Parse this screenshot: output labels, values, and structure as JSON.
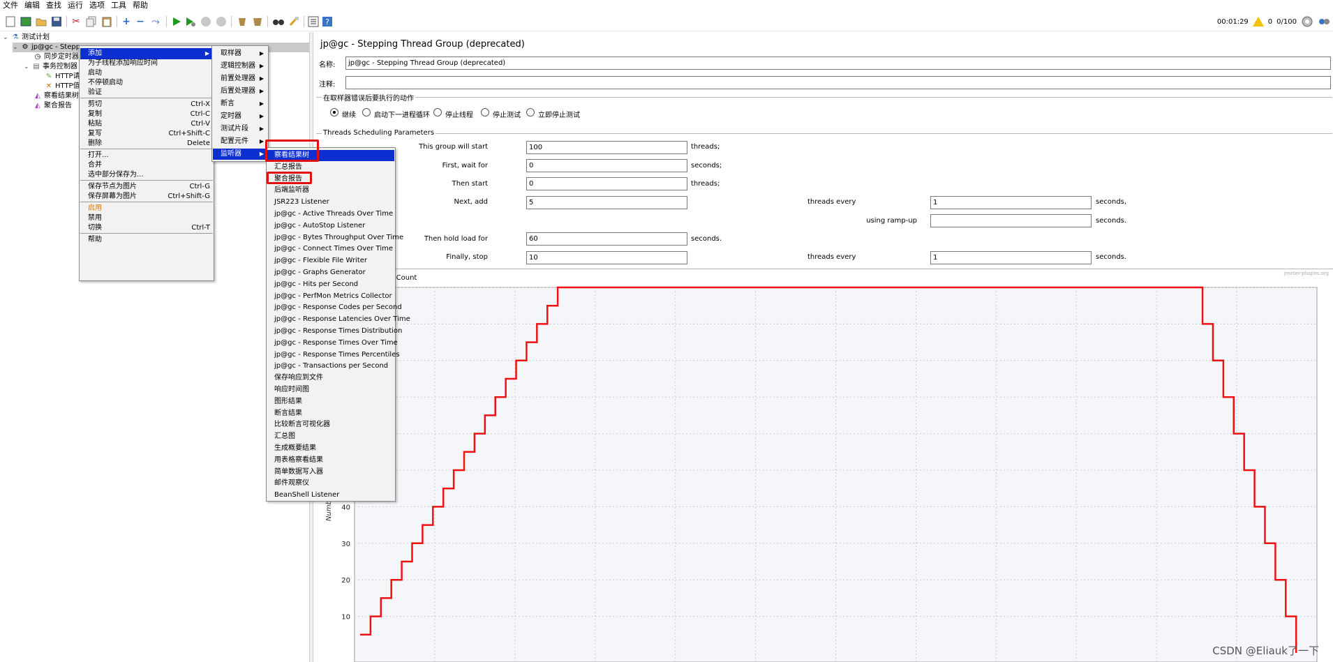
{
  "menubar": [
    "文件",
    "编辑",
    "查找",
    "运行",
    "选项",
    "工具",
    "帮助"
  ],
  "toolbar_right": {
    "timer": "00:01:29",
    "warn_count": "0",
    "threads": "0/100"
  },
  "tree": {
    "root": "测试计划",
    "group": "jp@gc - Stepp",
    "sync_timer": "同步定时器",
    "controller": "事务控制器",
    "http1": "HTTP请",
    "http2": "HTTP值",
    "view_results": "察看结果树",
    "aggregate": "聚合报告"
  },
  "ctx_menu": {
    "items": [
      {
        "label": "添加",
        "arrow": true,
        "selected": true
      },
      {
        "label": "为子线程添加响应时间"
      },
      {
        "label": "启动"
      },
      {
        "label": "不停顿启动"
      },
      {
        "label": "验证"
      },
      {
        "sep": true
      },
      {
        "label": "剪切",
        "sc": "Ctrl-X"
      },
      {
        "label": "复制",
        "sc": "Ctrl-C"
      },
      {
        "label": "粘贴",
        "sc": "Ctrl-V"
      },
      {
        "label": "复写",
        "sc": "Ctrl+Shift-C"
      },
      {
        "label": "删除",
        "sc": "Delete"
      },
      {
        "sep": true
      },
      {
        "label": "打开..."
      },
      {
        "label": "合并"
      },
      {
        "label": "选中部分保存为..."
      },
      {
        "sep": true
      },
      {
        "label": "保存节点为图片",
        "sc": "Ctrl-G"
      },
      {
        "label": "保存屏幕为图片",
        "sc": "Ctrl+Shift-G"
      },
      {
        "sep": true
      },
      {
        "label": "启用",
        "orange": true
      },
      {
        "label": "禁用"
      },
      {
        "label": "切换",
        "sc": "Ctrl-T"
      },
      {
        "sep": true
      },
      {
        "label": "帮助"
      }
    ]
  },
  "submenu_add": {
    "items": [
      {
        "label": "取样器"
      },
      {
        "label": "逻辑控制器"
      },
      {
        "label": "前置处理器"
      },
      {
        "label": "后置处理器"
      },
      {
        "label": "断言"
      },
      {
        "label": "定时器"
      },
      {
        "label": "测试片段"
      },
      {
        "label": "配置元件"
      },
      {
        "label": "监听器",
        "selected": true
      }
    ]
  },
  "submenu_listeners": {
    "items": [
      "察看结果树",
      "汇总报告",
      "聚合报告",
      "后端监听器",
      "JSR223 Listener",
      "jp@gc - Active Threads Over Time",
      "jp@gc - AutoStop Listener",
      "jp@gc - Bytes Throughput Over Time",
      "jp@gc - Connect Times Over Time",
      "jp@gc - Flexible File Writer",
      "jp@gc - Graphs Generator",
      "jp@gc - Hits per Second",
      "jp@gc - PerfMon Metrics Collector",
      "jp@gc - Response Codes per Second",
      "jp@gc - Response Latencies Over Time",
      "jp@gc - Response Times Distribution",
      "jp@gc - Response Times Over Time",
      "jp@gc - Response Times Percentiles",
      "jp@gc - Transactions per Second",
      "保存响应到文件",
      "响应时间图",
      "图形结果",
      "断言结果",
      "比较断言可视化器",
      "汇总图",
      "生成概要结果",
      "用表格察看结果",
      "简单数据写入器",
      "邮件观察仪",
      "BeanShell Listener"
    ]
  },
  "panel": {
    "title": "jp@gc - Stepping Thread Group (deprecated)",
    "name_label": "名称:",
    "name_value": "jp@gc - Stepping Thread Group (deprecated)",
    "comment_label": "注释:",
    "comment_value": "",
    "error_section": "在取样器错误后要执行的动作",
    "error_options": [
      "继续",
      "启动下一进程循环",
      "停止线程",
      "停止测试",
      "立即停止测试"
    ],
    "sched_section": "Threads Scheduling Parameters",
    "rows": {
      "start_label": "This group will start",
      "start_value": "100",
      "start_unit": "threads;",
      "wait_label": "First, wait for",
      "wait_value": "0",
      "wait_unit": "seconds;",
      "then_label": "Then start",
      "then_value": "0",
      "then_unit": "threads;",
      "next_label": "Next, add",
      "next_value": "5",
      "next_mid": "threads every",
      "next_value2": "1",
      "next_unit": "seconds,",
      "ramp_label": "using ramp-up",
      "ramp_value": "",
      "ramp_unit": "seconds.",
      "hold_label": "Then hold load for",
      "hold_value": "60",
      "hold_unit": "seconds.",
      "stop_label": "Finally, stop",
      "stop_value": "10",
      "stop_mid": "threads every",
      "stop_value2": "1",
      "stop_unit": "seconds."
    }
  },
  "chart_data": {
    "type": "line",
    "title": "ers Count",
    "ylabel": "Numb",
    "watermark_small": "jmeter-plugins.org",
    "yticks": [
      10,
      20,
      30,
      40
    ],
    "ylim": [
      0,
      100
    ],
    "series": [
      {
        "color": "#ee1111",
        "x": [
          0,
          1,
          2,
          3,
          4,
          5,
          6,
          7,
          8,
          9,
          10,
          11,
          12,
          13,
          14,
          15,
          16,
          17,
          18,
          19,
          20,
          80,
          81,
          82,
          83,
          84,
          85,
          86,
          87,
          88,
          89,
          90
        ],
        "y": [
          5,
          10,
          15,
          20,
          25,
          30,
          35,
          40,
          45,
          50,
          55,
          60,
          65,
          70,
          75,
          80,
          85,
          90,
          95,
          100,
          100,
          100,
          90,
          80,
          70,
          60,
          50,
          40,
          30,
          20,
          10,
          0
        ]
      }
    ]
  },
  "footer_watermark": "CSDN @Eliauk了一下"
}
